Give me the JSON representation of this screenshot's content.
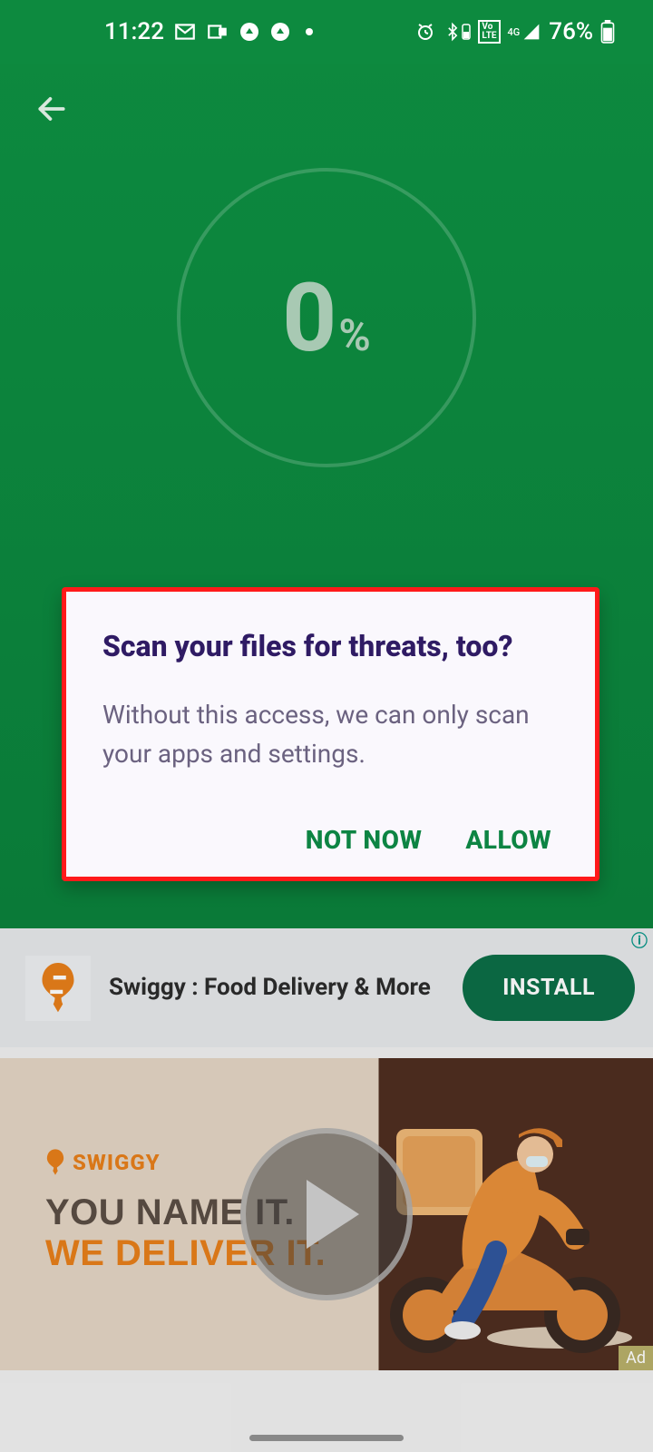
{
  "status_bar": {
    "time": "11:22",
    "battery_pct": "76%"
  },
  "scan": {
    "progress_value": "0",
    "progress_unit": "%"
  },
  "dialog": {
    "title": "Scan your files for threats, too?",
    "body": "Without this access, we can only scan your apps and settings.",
    "not_now": "NOT NOW",
    "allow": "ALLOW"
  },
  "ad_strip": {
    "title": "Swiggy : Food Delivery & More",
    "install": "INSTALL"
  },
  "banner": {
    "brand": "SWIGGY",
    "line1": "YOU NAME IT.",
    "line2": "WE DELIVER IT.",
    "badge": "Ad"
  }
}
